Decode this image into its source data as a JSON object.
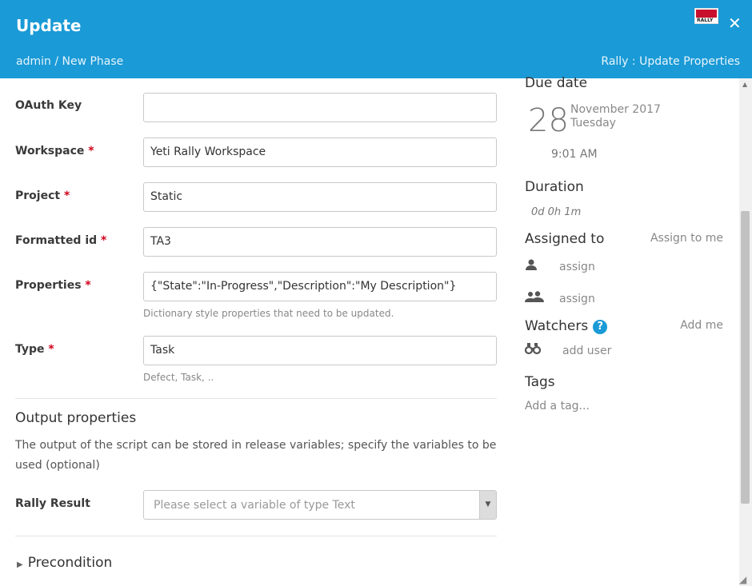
{
  "header": {
    "title": "Update",
    "breadcrumb": "admin / New Phase",
    "plugin_title": "Rally : Update Properties",
    "logo_text": "RALLY",
    "close_label": "✕",
    "background": "#1a9ad6"
  },
  "form": {
    "required_marker": "*",
    "oauth": {
      "label": "OAuth Key",
      "value": ""
    },
    "workspace": {
      "label": "Workspace",
      "value": "Yeti Rally Workspace"
    },
    "project": {
      "label": "Project",
      "value": "Static"
    },
    "formatted_id": {
      "label": "Formatted id",
      "value": "TA3"
    },
    "properties": {
      "label": "Properties",
      "value": "{\"State\":\"In-Progress\",\"Description\":\"My Description\"}",
      "hint": "Dictionary style properties that need to be updated."
    },
    "type": {
      "label": "Type",
      "value": "Task",
      "hint": "Defect, Task, .."
    }
  },
  "output": {
    "title": "Output properties",
    "description": "The output of the script can be stored in release variables; specify the variables to be used (optional)",
    "rally_result": {
      "label": "Rally Result",
      "placeholder": "Please select a variable of type Text"
    }
  },
  "precondition": {
    "label": "Precondition"
  },
  "sidebar": {
    "due_date": {
      "title": "Due date",
      "day": "28",
      "month_year": "November 2017",
      "weekday": "Tuesday",
      "time": "9:01 AM"
    },
    "duration": {
      "title": "Duration",
      "value": "0d 0h 1m"
    },
    "assigned": {
      "title": "Assigned to",
      "assign_me": "Assign to me",
      "user_assign": "assign",
      "team_assign": "assign"
    },
    "watchers": {
      "title": "Watchers",
      "help": "?",
      "add_me": "Add me",
      "add_user": "add user"
    },
    "tags": {
      "title": "Tags",
      "placeholder": "Add a tag..."
    }
  }
}
